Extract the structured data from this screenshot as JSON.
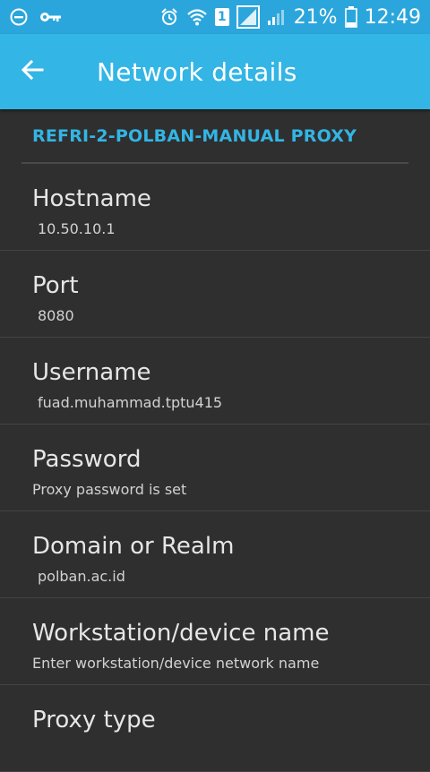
{
  "status_bar": {
    "battery_percent": "21%",
    "time": "12:49",
    "sim_slot": "1",
    "icons": [
      "minus-circle-icon",
      "key-icon",
      "alarm-icon",
      "wifi-icon",
      "sim-icon",
      "signal-icon",
      "signal-icon",
      "battery-icon"
    ]
  },
  "action_bar": {
    "title": "Network details",
    "back_icon": "arrow-left-icon"
  },
  "section": {
    "header": "REFRI-2-POLBAN-MANUAL PROXY"
  },
  "fields": [
    {
      "title": "Hostname",
      "summary": "10.50.10.1"
    },
    {
      "title": "Port",
      "summary": "8080"
    },
    {
      "title": "Username",
      "summary": "fuad.muhammad.tptu415"
    },
    {
      "title": "Password",
      "summary": "Proxy password is set"
    },
    {
      "title": "Domain or Realm",
      "summary": "polban.ac.id"
    },
    {
      "title": "Workstation/device name",
      "summary": "Enter workstation/device network name"
    },
    {
      "title": "Proxy type",
      "summary": ""
    }
  ],
  "colors": {
    "status_bar": "#2ba6dc",
    "action_bar": "#33b5e5",
    "background": "#2f2f2f",
    "accent": "#33b5e5"
  }
}
